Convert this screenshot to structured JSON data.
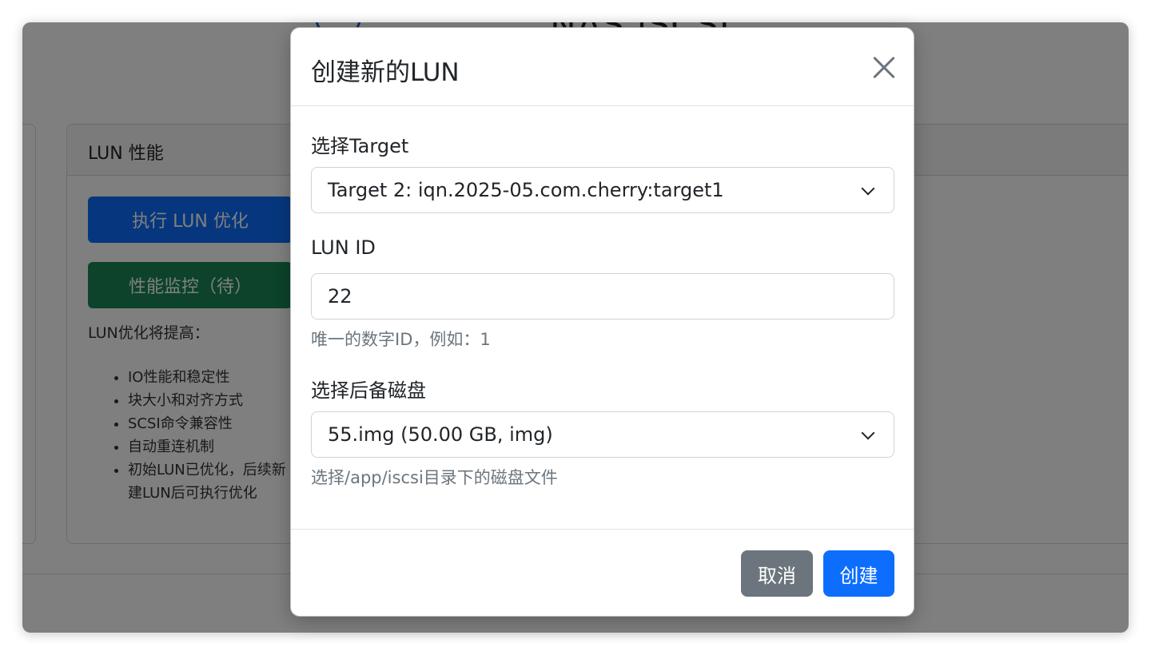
{
  "background": {
    "app_title": "NAS iSCSI",
    "card_title": "LUN 性能",
    "optimize_button": "执行 LUN 优化",
    "monitor_button": "性能监控（待）",
    "note": "LUN优化将提高：",
    "bullets": [
      "IO性能和稳定性",
      "块大小和对齐方式",
      "SCSI命令兼容性",
      "自动重连机制",
      "初始LUN已优化，后续新建LUN后可执行优化"
    ]
  },
  "modal": {
    "title": "创建新的LUN",
    "target_label": "选择Target",
    "target_value": "Target 2: iqn.2025-05.com.cherry:target1",
    "lun_id_label": "LUN ID",
    "lun_id_value": "22",
    "lun_id_help": "唯一的数字ID，例如：1",
    "disk_label": "选择后备磁盘",
    "disk_value": "55.img (50.00 GB, img)",
    "disk_help": "选择/app/iscsi目录下的磁盘文件",
    "cancel_label": "取消",
    "create_label": "创建"
  },
  "colors": {
    "primary": "#0d6efd",
    "secondary": "#6c757d",
    "success": "#198754",
    "overlay": "rgba(0,0,0,0.5)"
  }
}
